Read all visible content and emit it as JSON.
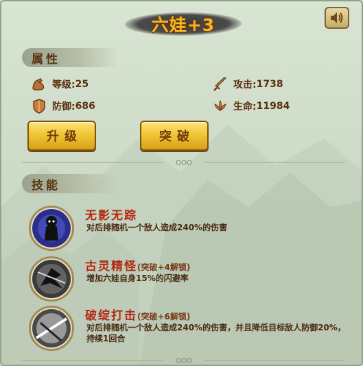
{
  "title": "六娃+3",
  "sections": {
    "attributes": "属性",
    "skills": "技能"
  },
  "stats": {
    "level_label": "等级:",
    "level_value": "25",
    "attack_label": "攻击:",
    "attack_value": "1738",
    "defense_label": "防御:",
    "defense_value": "686",
    "hp_label": "生命:",
    "hp_value": "11984"
  },
  "buttons": {
    "upgrade": "升级",
    "breakthrough": "突破"
  },
  "skills": [
    {
      "name": "无影无踪",
      "unlock": "",
      "desc": "对后排随机一个敌人造成240%的伤害",
      "icon": "invisible-doll-icon"
    },
    {
      "name": "古灵精怪",
      "unlock": "(突破+4解锁)",
      "desc": "增加六娃自身15%的闪避率",
      "icon": "shadow-strike-icon"
    },
    {
      "name": "破绽打击",
      "unlock": "(突破+6解锁)",
      "desc": "对后排随机一个敌人造成240%的伤害，并且降低目标敌人防御20%，持续1回合",
      "icon": "slash-icon"
    }
  ],
  "colors": {
    "title_gold": "#f4b52a",
    "skill_name_red": "#b12a12",
    "button_gold": "#f1c636"
  }
}
